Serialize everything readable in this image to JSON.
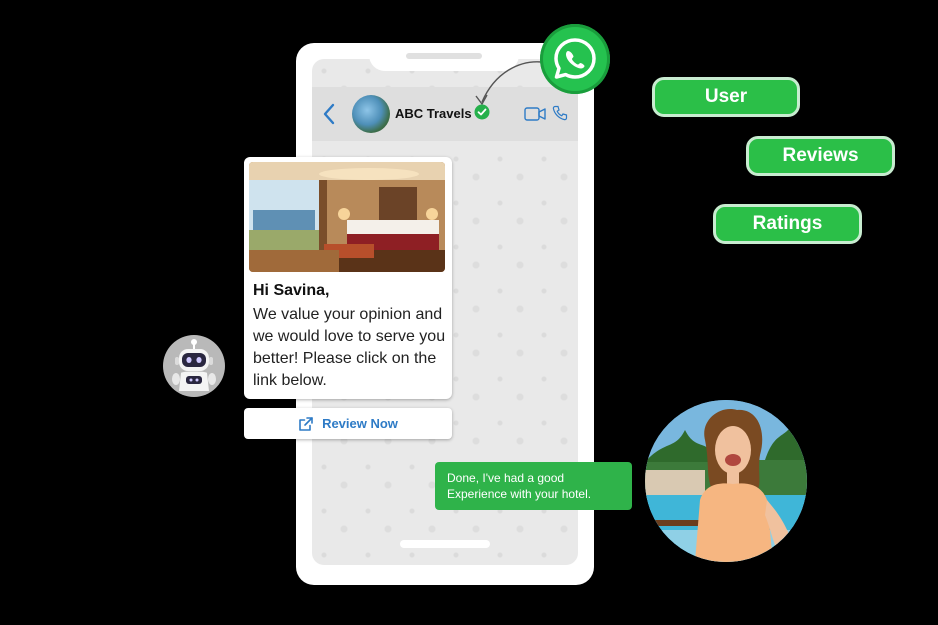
{
  "contact": {
    "name": "ABC Travels"
  },
  "message": {
    "greeting": "Hi Savina,",
    "body": "We value your opinion and we would love to serve you better! Please click on the link below."
  },
  "cta": {
    "label": "Review Now"
  },
  "reply": {
    "text": "Done, I've had a good Experience with your hotel."
  },
  "pills": [
    {
      "label": "User"
    },
    {
      "label": "Reviews"
    },
    {
      "label": "Ratings"
    }
  ],
  "colors": {
    "whatsapp_green": "#25c24f",
    "pill_green": "#2bbf48",
    "link_blue": "#2e7bc6"
  }
}
